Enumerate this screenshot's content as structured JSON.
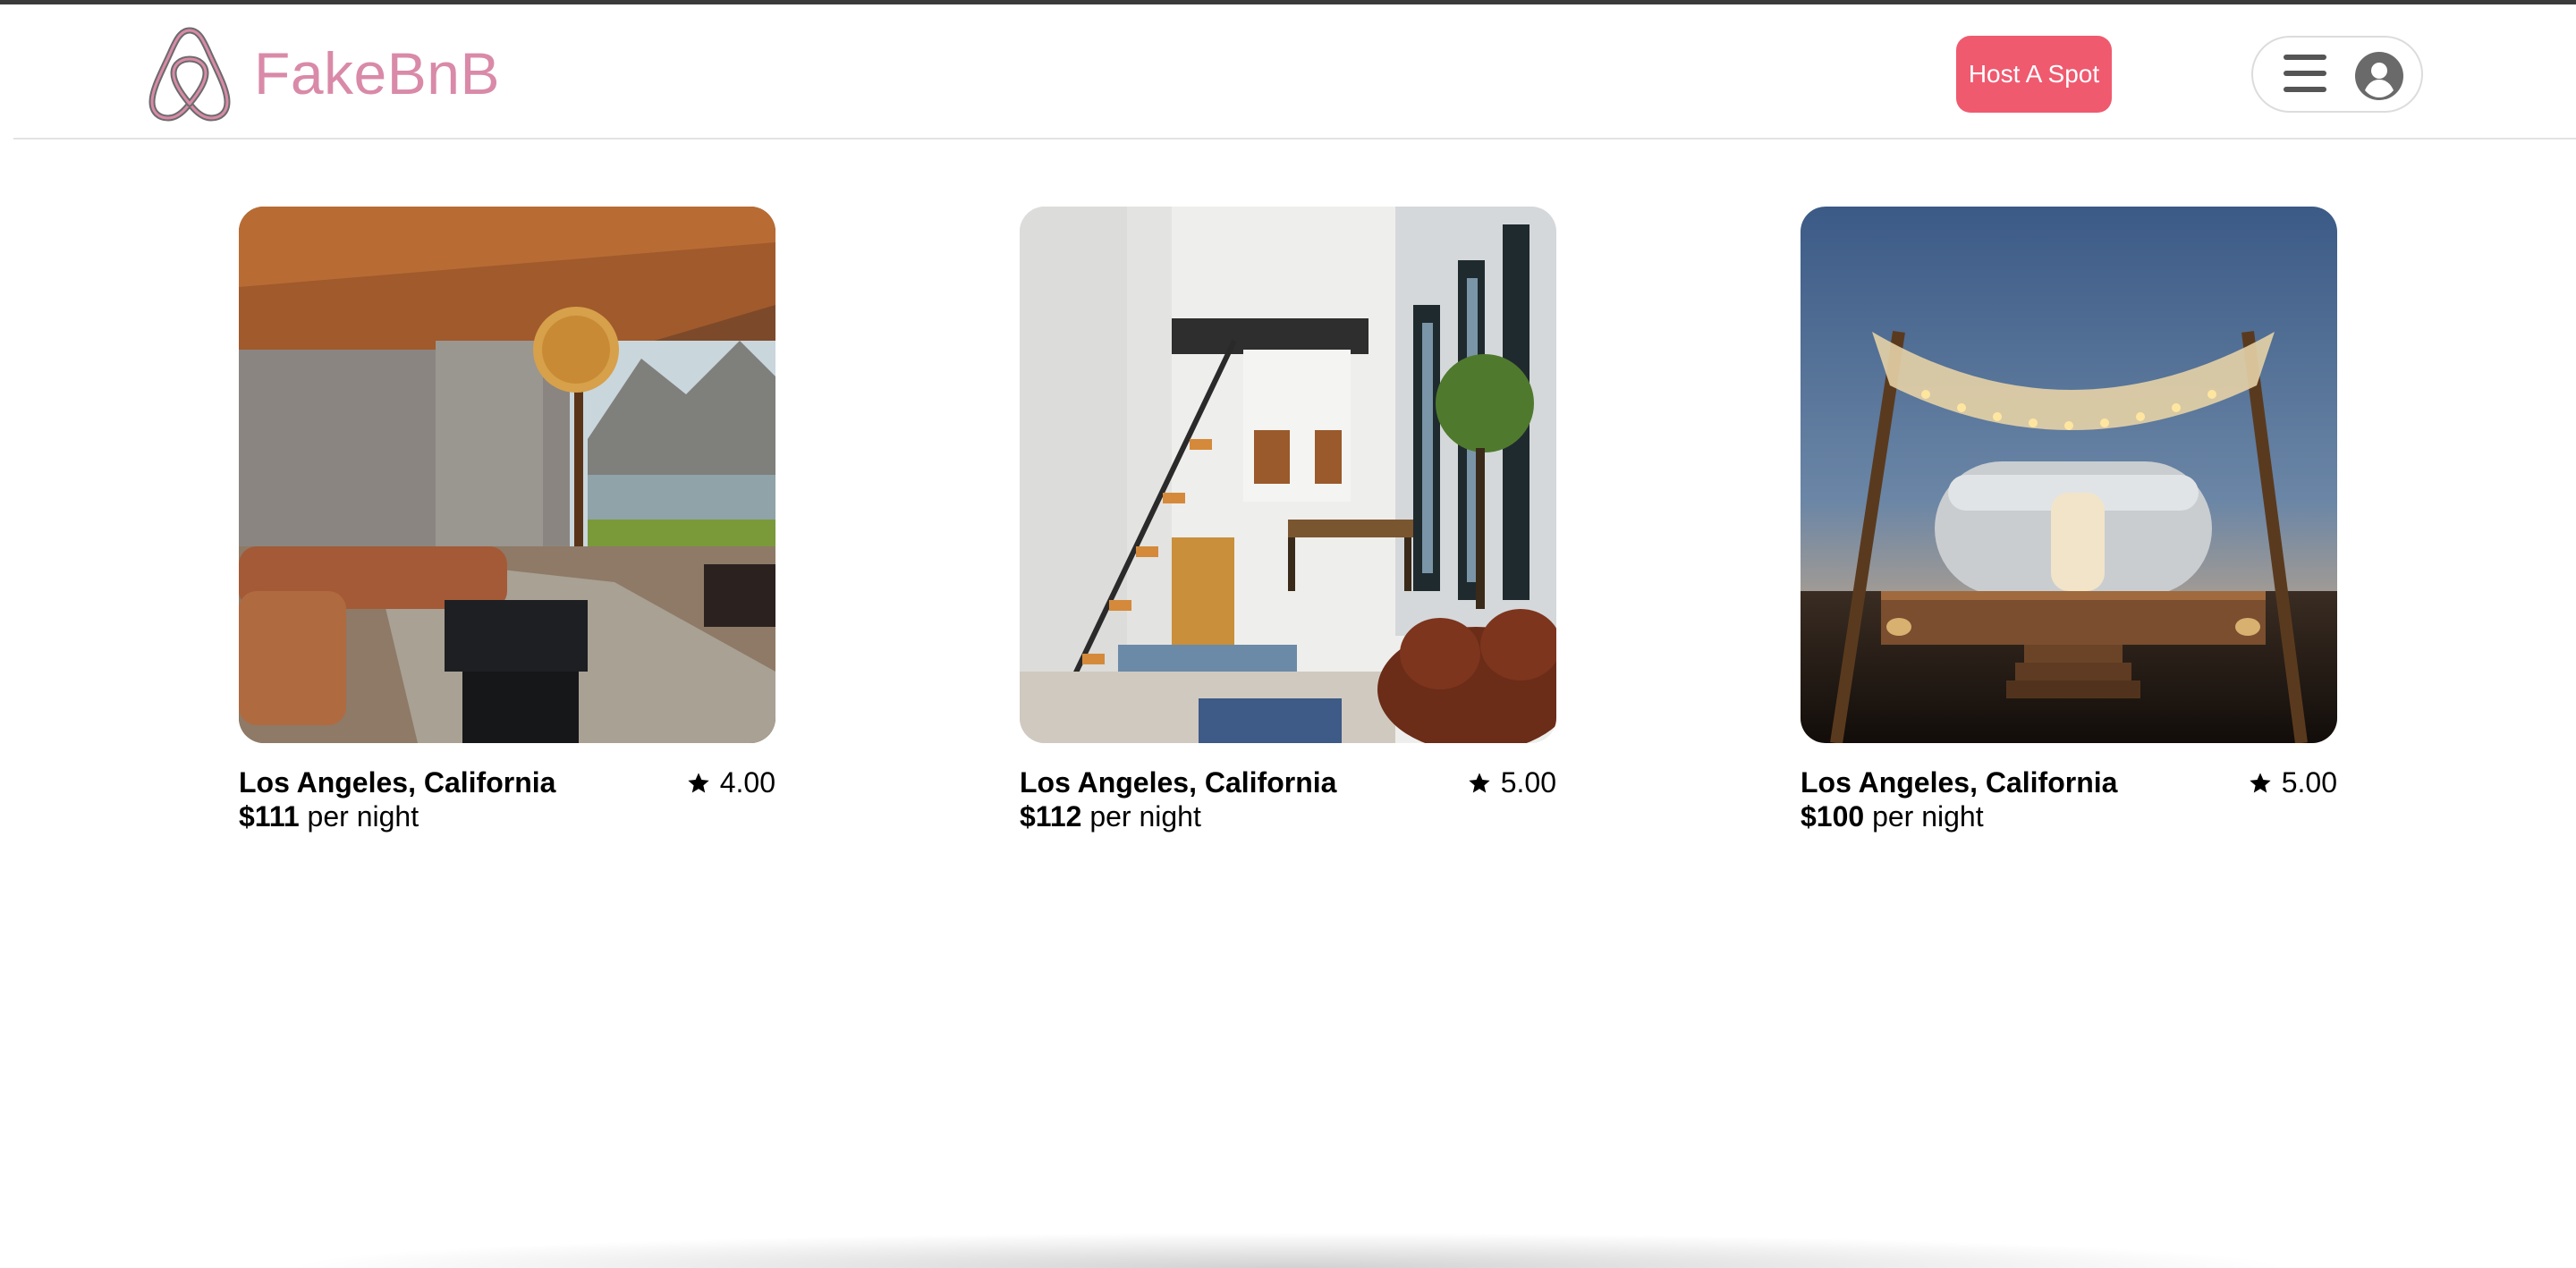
{
  "header": {
    "brand": "FakeBnB",
    "host_button": "Host A Spot",
    "menu_icon": "hamburger-icon",
    "profile_icon": "user-circle-icon"
  },
  "colors": {
    "brand_text": "#d98aa8",
    "accent": "#ef5a6f"
  },
  "listings": [
    {
      "location": "Los Angeles, California",
      "rating": "4.00",
      "price": "$111",
      "price_suffix": "per night",
      "image": "modern living room with mountain lake view"
    },
    {
      "location": "Los Angeles, California",
      "rating": "5.00",
      "price": "$112",
      "price_suffix": "per night",
      "image": "bright interior with staircase and dining area"
    },
    {
      "location": "Los Angeles, California",
      "rating": "5.00",
      "price": "$100",
      "price_suffix": "per night",
      "image": "airstream trailer on deck with string lights at dusk"
    }
  ]
}
